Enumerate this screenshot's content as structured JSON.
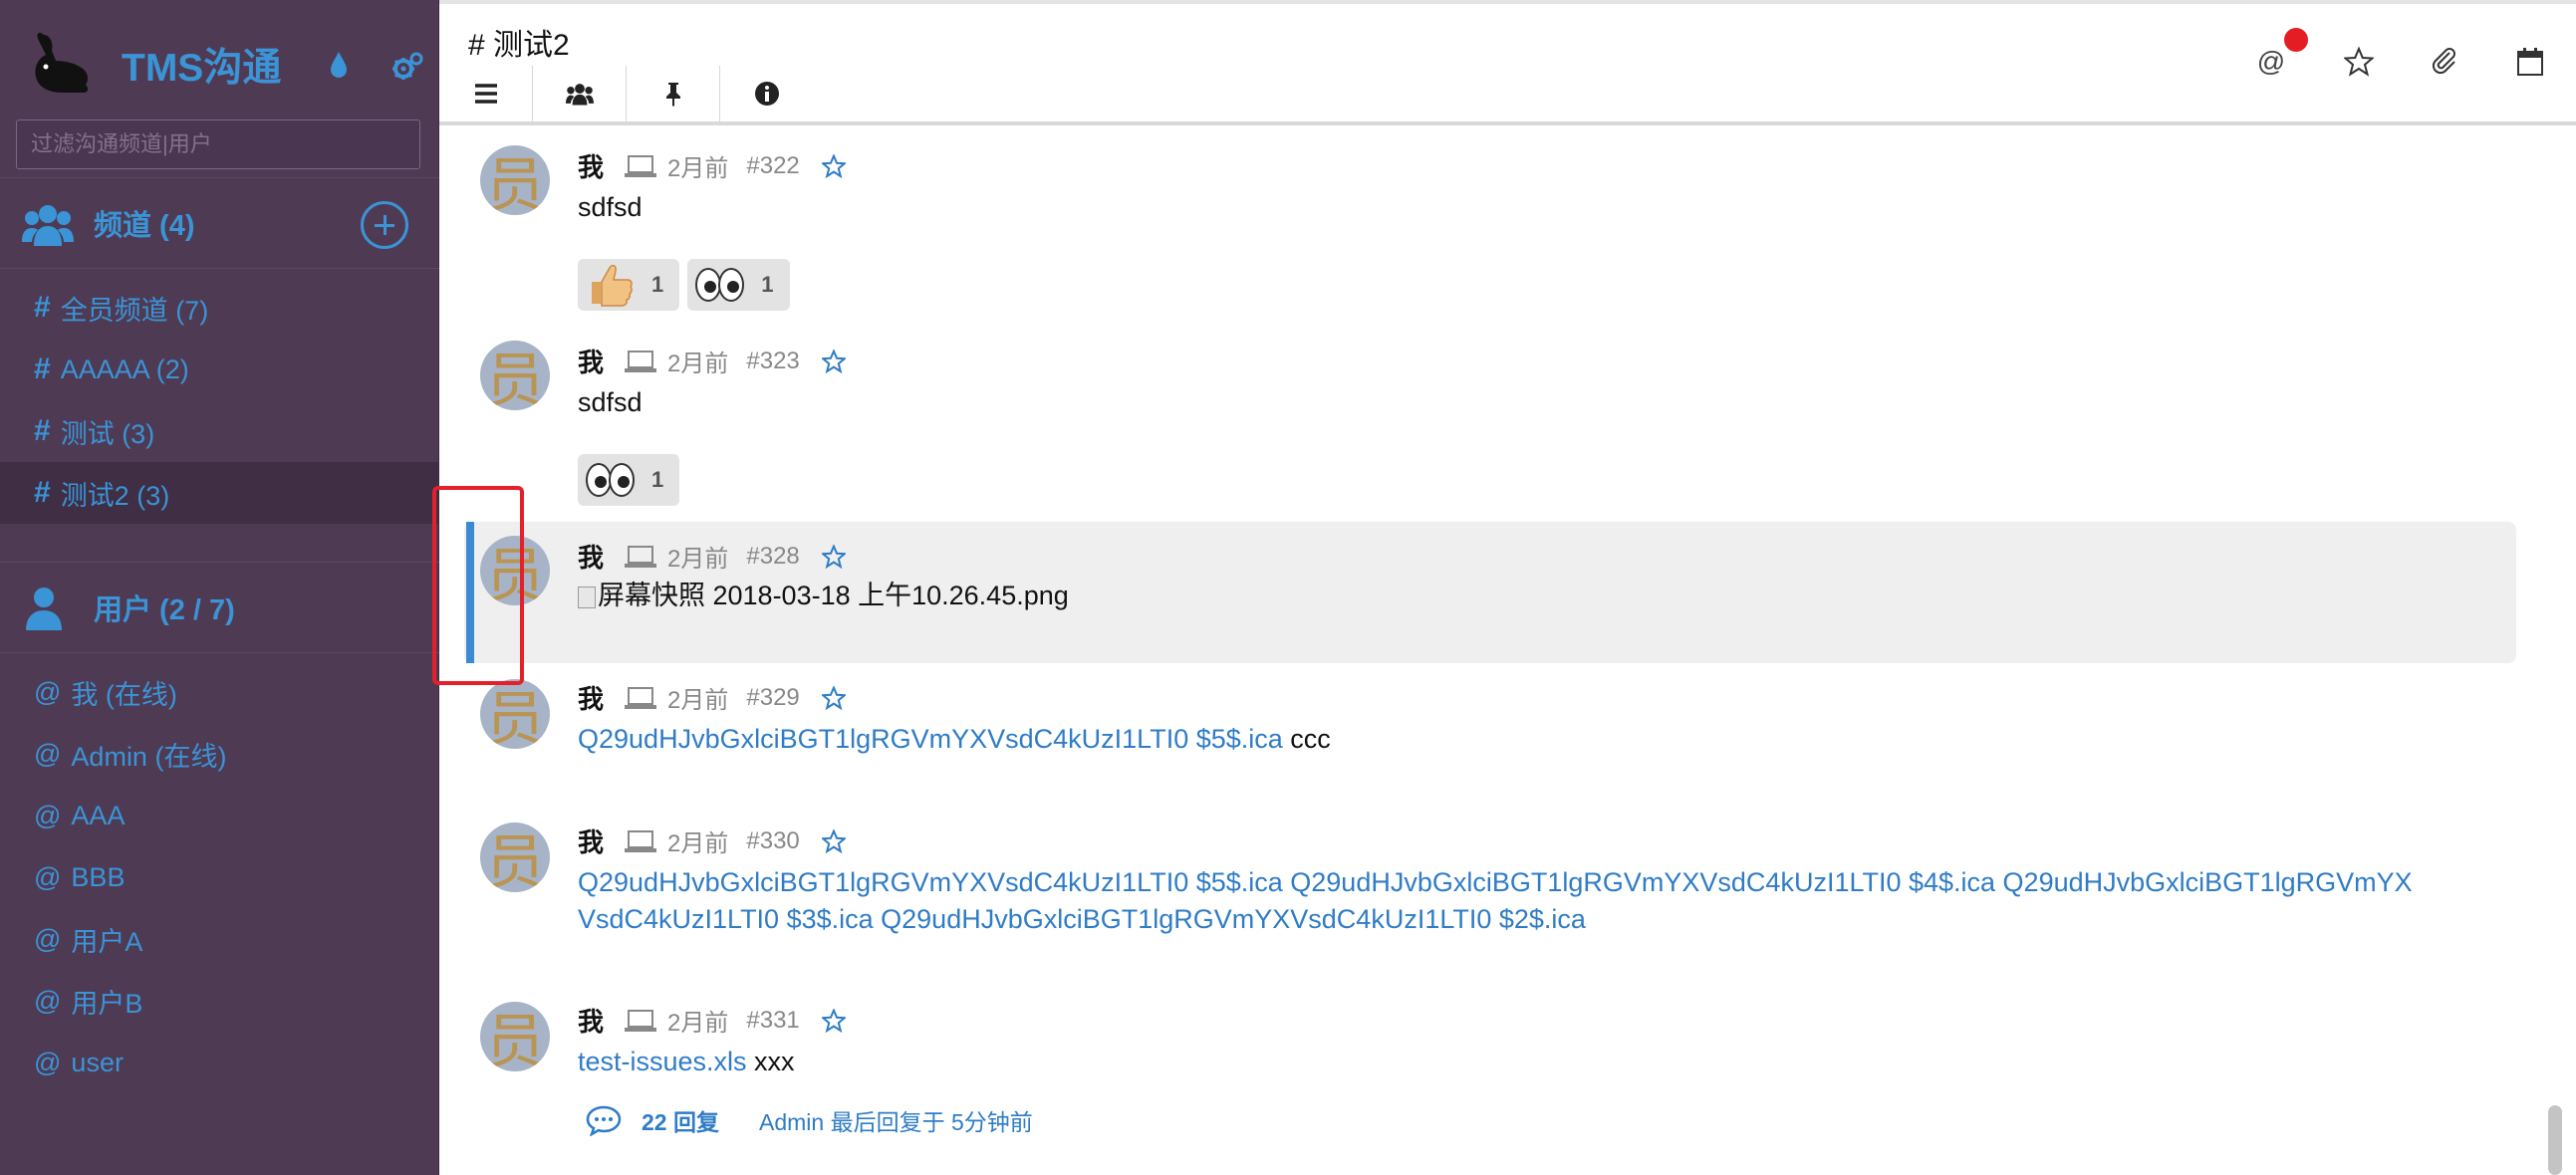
{
  "app": {
    "title": "TMS沟通"
  },
  "sidebar": {
    "filter_placeholder": "过滤沟通频道|用户",
    "channels_header": "频道 (4)",
    "channels": [
      {
        "label": "全员频道 (7)",
        "active": false
      },
      {
        "label": "AAAAA (2)",
        "active": false
      },
      {
        "label": "测试 (3)",
        "active": false
      },
      {
        "label": "测试2 (3)",
        "active": true
      }
    ],
    "users_header": "用户 (2 / 7)",
    "users": [
      {
        "label": "我 (在线)"
      },
      {
        "label": "Admin (在线)"
      },
      {
        "label": "AAA"
      },
      {
        "label": "BBB"
      },
      {
        "label": "用户A"
      },
      {
        "label": "用户B"
      },
      {
        "label": "user"
      }
    ]
  },
  "header": {
    "channel_title": "# 测试2",
    "mention_symbol": "@",
    "icons": [
      "menu-icon",
      "users-icon",
      "pin-icon",
      "info-icon",
      "mention-icon",
      "star-icon",
      "paperclip-icon",
      "calendar-icon"
    ]
  },
  "messages": [
    {
      "author": "我",
      "time": "2月前",
      "number": "#322",
      "text": "sdfsd",
      "avatar_char": "员",
      "reactions": [
        {
          "emoji": "thumbs-up",
          "count": "1"
        },
        {
          "emoji": "eyes",
          "count": "1"
        }
      ]
    },
    {
      "author": "我",
      "time": "2月前",
      "number": "#323",
      "text": "sdfsd",
      "avatar_char": "员",
      "reactions": [
        {
          "emoji": "eyes",
          "count": "1"
        }
      ]
    },
    {
      "author": "我",
      "time": "2月前",
      "number": "#328",
      "avatar_char": "员",
      "highlighted": true,
      "image_alt": "屏幕快照 2018-03-18 上午10.26.45.png"
    },
    {
      "author": "我",
      "time": "2月前",
      "number": "#329",
      "avatar_char": "员",
      "link": "Q29udHJvbGxlciBGT1lgRGVmYXVsdC4kUzI1LTI0 $5$.ica",
      "suffix": " ccc"
    },
    {
      "author": "我",
      "time": "2月前",
      "number": "#330",
      "avatar_char": "员",
      "line1": "Q29udHJvbGxlciBGT1lgRGVmYXVsdC4kUzI1LTI0 $5$.ica Q29udHJvbGxlciBGT1lgRGVmYXVsdC4kUzI1LTI0 $4$.ica Q29udHJvbGxlciBGT1lgRGVmYX",
      "line2": "VsdC4kUzI1LTI0 $3$.ica Q29udHJvbGxlciBGT1lgRGVmYXVsdC4kUzI1LTI0 $2$.ica"
    },
    {
      "author": "我",
      "time": "2月前",
      "number": "#331",
      "avatar_char": "员",
      "link": "test-issues.xls",
      "suffix": " xxx",
      "replies": {
        "count": "22 回复",
        "last": "Admin 最后回复于 5分钟前"
      }
    }
  ],
  "colors": {
    "sidebar_bg": "#4f3a54",
    "accent": "#3a94d6",
    "link": "#2f7cc6",
    "highlight_bar": "#3a8bd4",
    "mention_dot": "#e41c23"
  }
}
